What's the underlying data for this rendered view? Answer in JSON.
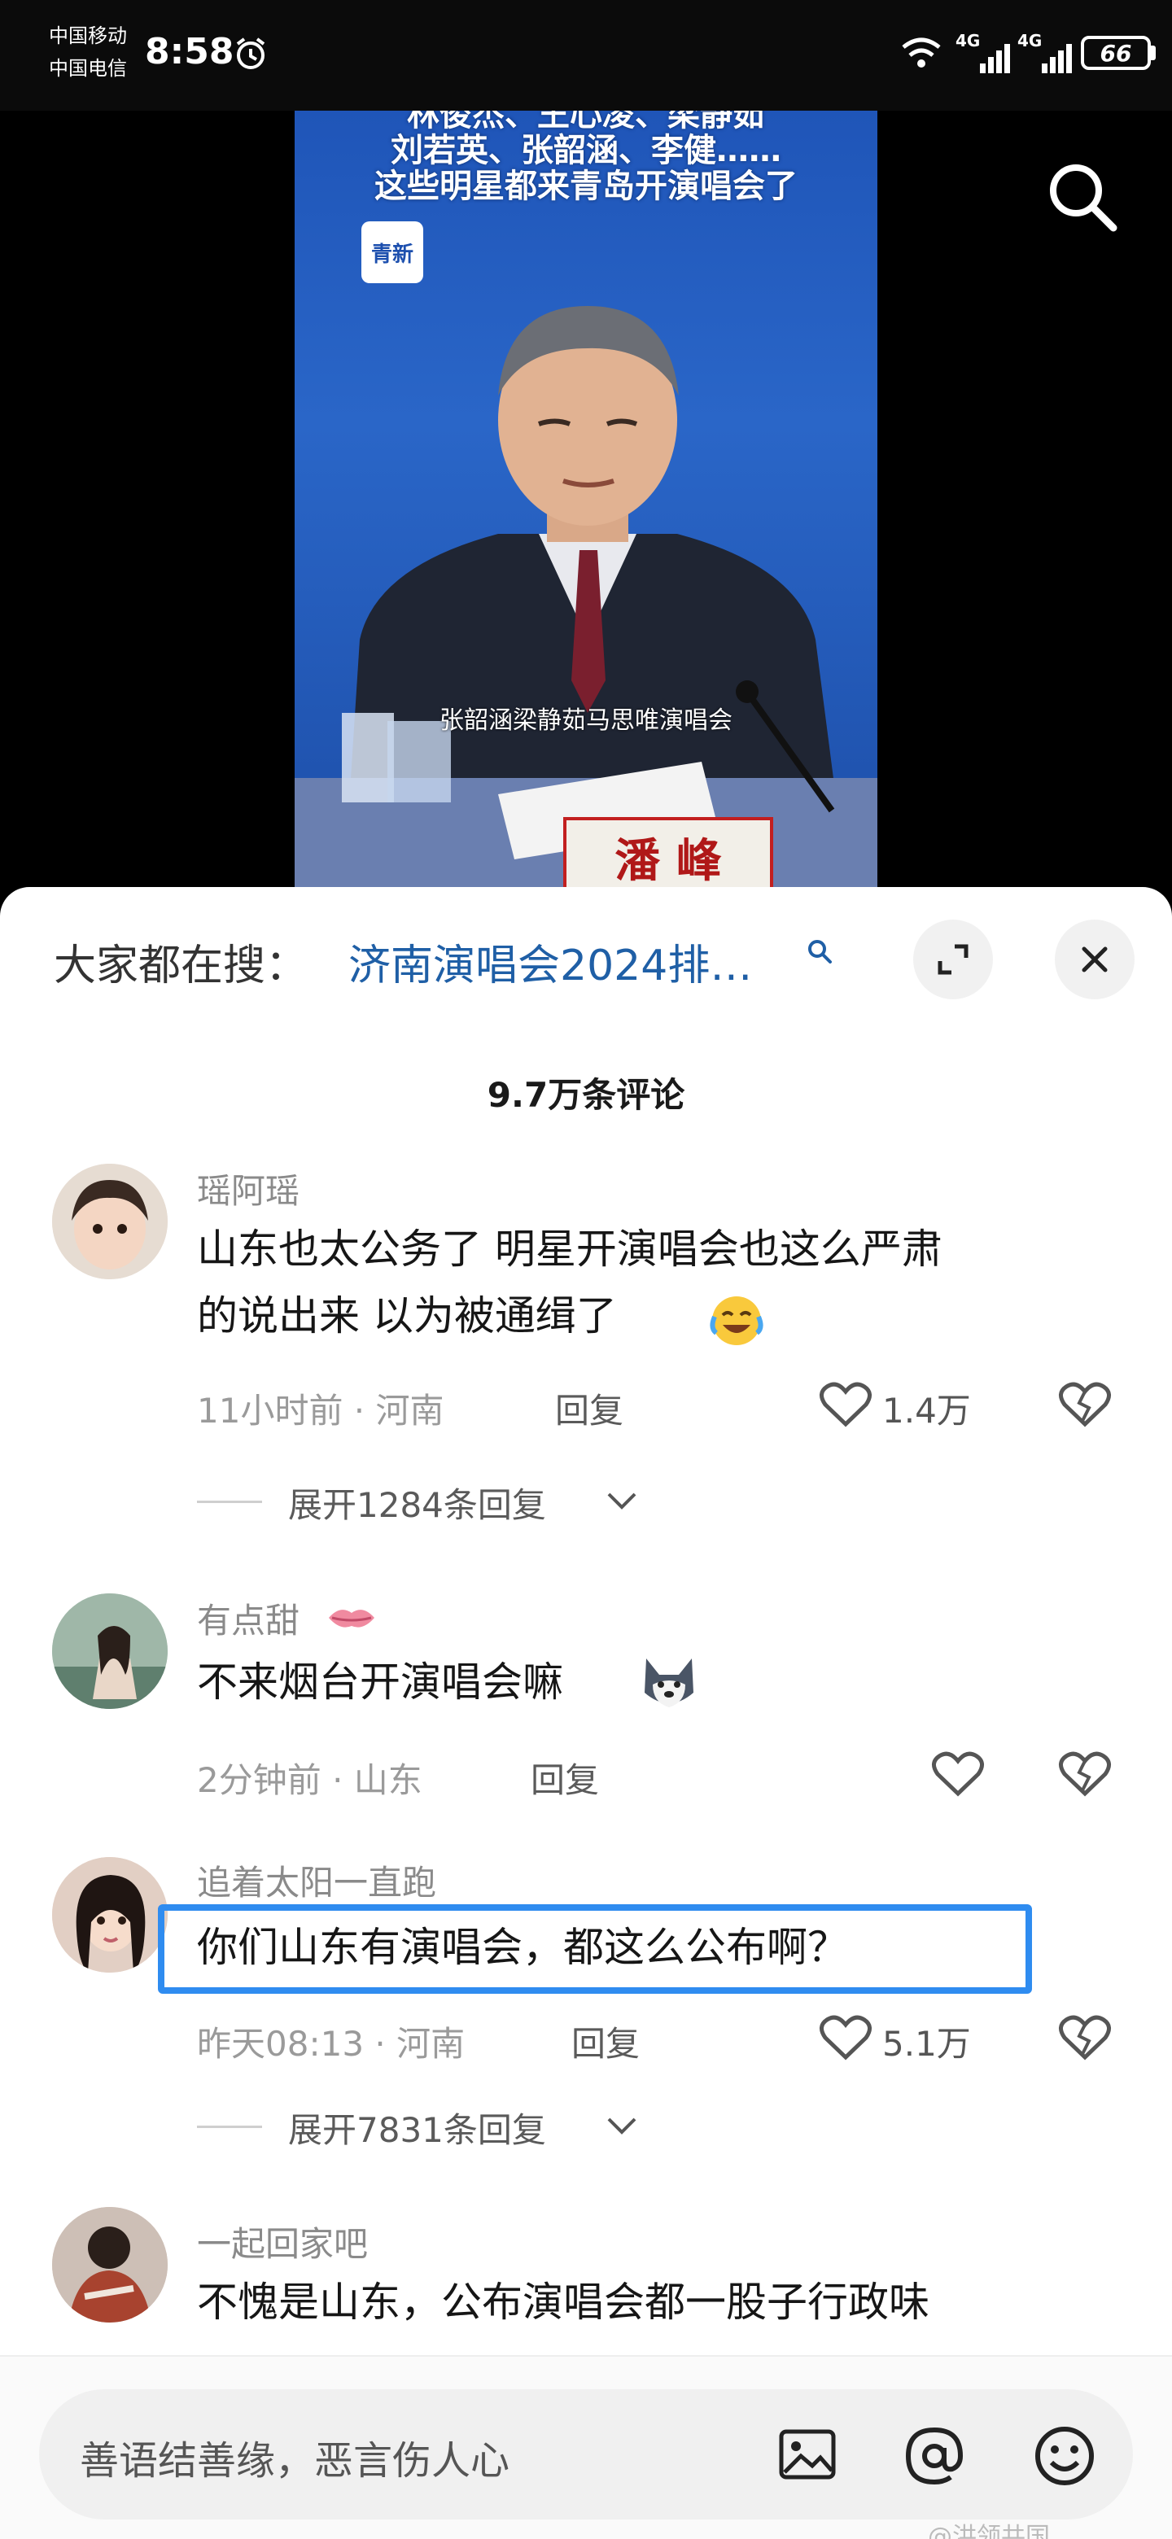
{
  "status_bar": {
    "carrier_1": "中国移动",
    "carrier_2": "中国电信",
    "time": "8:58",
    "network_1": "4G",
    "network_2": "4G",
    "battery": "66"
  },
  "video": {
    "title_line_1": "林俊杰、王心凌、梁静茹",
    "title_line_2": "刘若英、张韶涵、李健……",
    "title_line_3": "这些明星都来青岛开演唱会了",
    "logo": "青新",
    "subtitle": "张韶涵梁静茹马思唯演唱会",
    "name_plate": "潘 峰"
  },
  "search_bar": {
    "prefix": "大家都在搜：",
    "query": "济南演唱会2024排…"
  },
  "comments_header": {
    "count_label": "9.7万条评论"
  },
  "comments": [
    {
      "name": "瑶阿瑶",
      "text_line_1": "山东也太公务了  明星开演唱会也这么严肃",
      "text_line_2": "的说出来  以为被通缉了",
      "time": "11小时前 · 河南",
      "reply": "回复",
      "likes": "1.4万",
      "expand": "展开1284条回复"
    },
    {
      "name": "有点甜",
      "text_line_1": "不来烟台开演唱会嘛",
      "time": "2分钟前 · 山东",
      "reply": "回复"
    },
    {
      "name": "追着太阳一直跑",
      "text_line_1": "你们山东有演唱会，都这么公布啊？",
      "time": "昨天08:13 · 河南",
      "reply": "回复",
      "likes": "5.1万",
      "expand": "展开7831条回复"
    },
    {
      "name": "一起回家吧",
      "text_line_1": "不愧是山东，公布演唱会都一股子行政味"
    }
  ],
  "input_bar": {
    "placeholder": "善语结善缘，恶言伤人心",
    "watermark": "@洪领共国"
  },
  "colors": {
    "highlight_box": "#2f8cf0",
    "query_text": "#1f5fa6",
    "video_bg": "#1c4fae"
  }
}
